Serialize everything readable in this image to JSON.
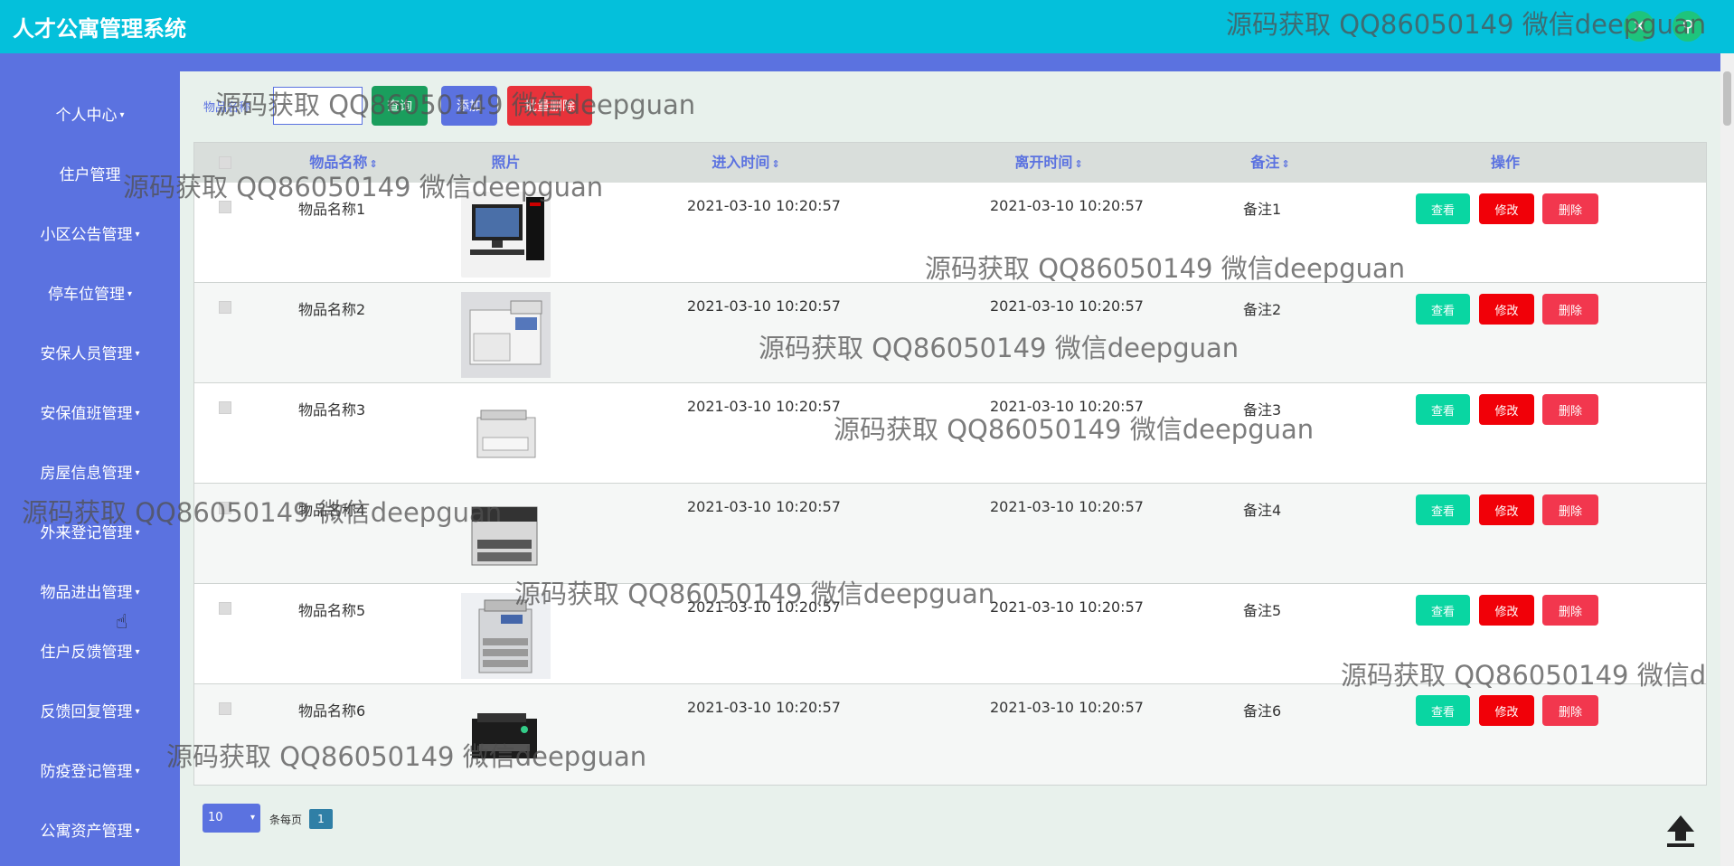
{
  "app": {
    "title": "人才公寓管理系统"
  },
  "sidebar": {
    "items": [
      {
        "label": "个人中心"
      },
      {
        "label": "住户管理"
      },
      {
        "label": "小区公告管理"
      },
      {
        "label": "停车位管理"
      },
      {
        "label": "安保人员管理"
      },
      {
        "label": "安保值班管理"
      },
      {
        "label": "房屋信息管理"
      },
      {
        "label": "外来登记管理"
      },
      {
        "label": "物品进出管理"
      },
      {
        "label": "住户反馈管理"
      },
      {
        "label": "反馈回复管理"
      },
      {
        "label": "防疫登记管理"
      },
      {
        "label": "公寓资产管理"
      }
    ]
  },
  "search": {
    "label": "物品名称",
    "query_button": "查询",
    "add_button": "添加",
    "batch_delete_button": "批量删除"
  },
  "table": {
    "headers": {
      "name": "物品名称",
      "photo": "照片",
      "in_time": "进入时间",
      "out_time": "离开时间",
      "remark": "备注",
      "actions": "操作"
    },
    "rows": [
      {
        "name": "物品名称1",
        "in_time": "2021-03-10 10:20:57",
        "out_time": "2021-03-10 10:20:57",
        "remark": "备注1",
        "photo_icon": "desktop-computer"
      },
      {
        "name": "物品名称2",
        "in_time": "2021-03-10 10:20:57",
        "out_time": "2021-03-10 10:20:57",
        "remark": "备注2",
        "photo_icon": "large-printer"
      },
      {
        "name": "物品名称3",
        "in_time": "2021-03-10 10:20:57",
        "out_time": "2021-03-10 10:20:57",
        "remark": "备注3",
        "photo_icon": "copier"
      },
      {
        "name": "物品名称4",
        "in_time": "2021-03-10 10:20:57",
        "out_time": "2021-03-10 10:20:57",
        "remark": "备注4",
        "photo_icon": "laser-printer"
      },
      {
        "name": "物品名称5",
        "in_time": "2021-03-10 10:20:57",
        "out_time": "2021-03-10 10:20:57",
        "remark": "备注5",
        "photo_icon": "office-copier"
      },
      {
        "name": "物品名称6",
        "in_time": "2021-03-10 10:20:57",
        "out_time": "2021-03-10 10:20:57",
        "remark": "备注6",
        "photo_icon": "inkjet-printer"
      }
    ],
    "action_labels": {
      "view": "查看",
      "edit": "修改",
      "delete": "删除"
    }
  },
  "pager": {
    "page_size": "10",
    "per_page_label": "条每页",
    "current_page": "1"
  },
  "watermark_text": "源码获取 QQ86050149 微信deepguan",
  "colors": {
    "topbar": "#04c0db",
    "sidebar": "#5b72e0",
    "view": "#09d6a2",
    "edit": "#f10008",
    "delete": "#f2374e"
  }
}
